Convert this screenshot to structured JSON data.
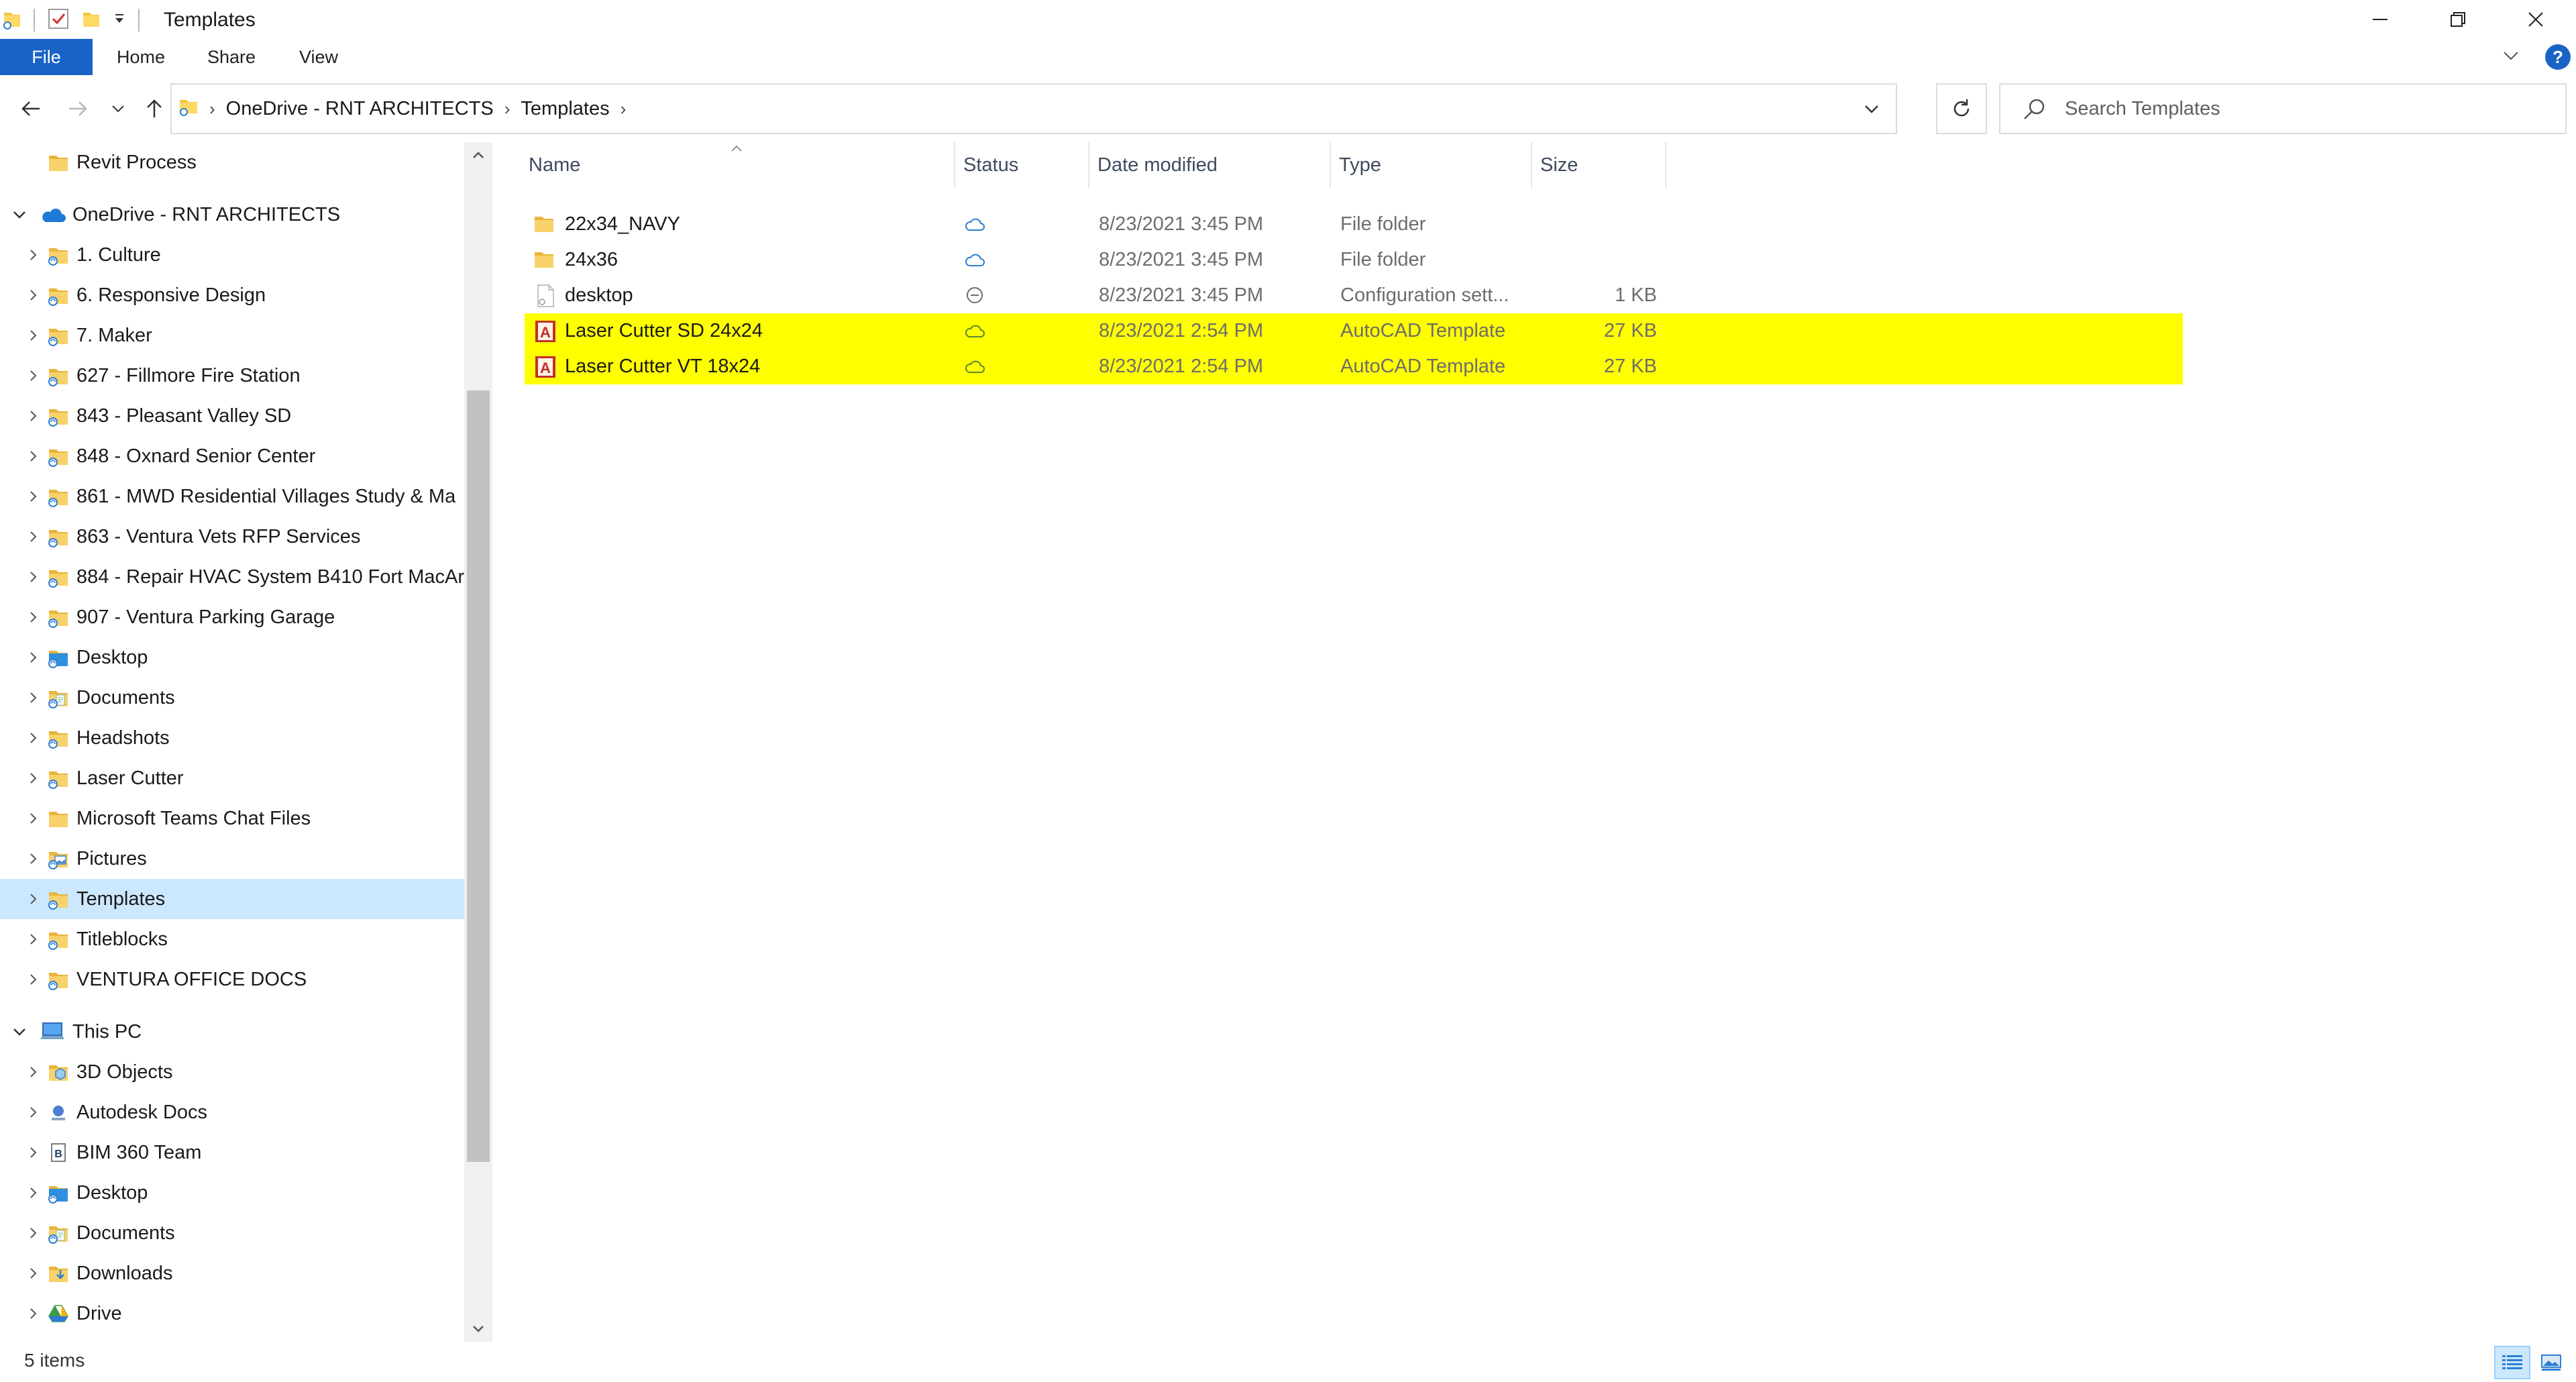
{
  "window": {
    "title": "Templates",
    "minimize_glyph": "—",
    "maximize_glyph": "❐",
    "close_glyph": "✕"
  },
  "ribbon": {
    "tabs": [
      "File",
      "Home",
      "Share",
      "View"
    ],
    "help_label": "?"
  },
  "address": {
    "crumbs": [
      "OneDrive - RNT ARCHITECTS",
      "Templates"
    ]
  },
  "search": {
    "placeholder": "Search Templates"
  },
  "nav_tree": [
    {
      "label": "Revit Process",
      "indent": 1,
      "icon": "folder-icon",
      "expander": "none"
    },
    {
      "label": "OneDrive - RNT ARCHITECTS",
      "indent": 0,
      "icon": "onedrive-cloud-icon",
      "expander": "expanded"
    },
    {
      "label": "1. Culture",
      "indent": 1,
      "icon": "sync-folder-icon",
      "expander": "collapsed"
    },
    {
      "label": "6. Responsive Design",
      "indent": 1,
      "icon": "sync-folder-icon",
      "expander": "collapsed"
    },
    {
      "label": "7. Maker",
      "indent": 1,
      "icon": "sync-folder-icon",
      "expander": "collapsed"
    },
    {
      "label": "627 - Fillmore Fire Station",
      "indent": 1,
      "icon": "sync-folder-icon",
      "expander": "collapsed"
    },
    {
      "label": "843 - Pleasant Valley SD",
      "indent": 1,
      "icon": "sync-folder-icon",
      "expander": "collapsed"
    },
    {
      "label": "848 - Oxnard Senior Center",
      "indent": 1,
      "icon": "sync-folder-icon",
      "expander": "collapsed"
    },
    {
      "label": "861 - MWD Residential Villages Study & Ma",
      "indent": 1,
      "icon": "sync-folder-icon",
      "expander": "collapsed"
    },
    {
      "label": "863 - Ventura Vets RFP Services",
      "indent": 1,
      "icon": "sync-folder-icon",
      "expander": "collapsed"
    },
    {
      "label": "884 - Repair HVAC System B410 Fort MacAr",
      "indent": 1,
      "icon": "sync-folder-icon",
      "expander": "collapsed"
    },
    {
      "label": "907 - Ventura Parking Garage",
      "indent": 1,
      "icon": "sync-folder-icon",
      "expander": "collapsed"
    },
    {
      "label": "Desktop",
      "indent": 1,
      "icon": "desktop-folder-icon",
      "expander": "collapsed"
    },
    {
      "label": "Documents",
      "indent": 1,
      "icon": "documents-folder-icon",
      "expander": "collapsed"
    },
    {
      "label": "Headshots",
      "indent": 1,
      "icon": "sync-folder-icon",
      "expander": "collapsed"
    },
    {
      "label": "Laser Cutter",
      "indent": 1,
      "icon": "sync-folder-icon",
      "expander": "collapsed"
    },
    {
      "label": "Microsoft Teams Chat Files",
      "indent": 1,
      "icon": "folder-icon",
      "expander": "collapsed"
    },
    {
      "label": "Pictures",
      "indent": 1,
      "icon": "pictures-folder-icon",
      "expander": "collapsed"
    },
    {
      "label": "Templates",
      "indent": 1,
      "icon": "sync-folder-icon",
      "expander": "collapsed",
      "selected": true
    },
    {
      "label": "Titleblocks",
      "indent": 1,
      "icon": "sync-folder-icon",
      "expander": "collapsed"
    },
    {
      "label": "VENTURA OFFICE DOCS",
      "indent": 1,
      "icon": "sync-folder-icon",
      "expander": "collapsed"
    },
    {
      "label": "This PC",
      "indent": 0,
      "icon": "this-pc-icon",
      "expander": "expanded"
    },
    {
      "label": "3D Objects",
      "indent": 1,
      "icon": "3d-objects-icon",
      "expander": "collapsed"
    },
    {
      "label": "Autodesk Docs",
      "indent": 1,
      "icon": "autodesk-docs-icon",
      "expander": "collapsed"
    },
    {
      "label": "BIM 360 Team",
      "indent": 1,
      "icon": "bim360-icon",
      "expander": "collapsed"
    },
    {
      "label": "Desktop",
      "indent": 1,
      "icon": "desktop-folder-icon",
      "expander": "collapsed"
    },
    {
      "label": "Documents",
      "indent": 1,
      "icon": "documents-folder-icon",
      "expander": "collapsed"
    },
    {
      "label": "Downloads",
      "indent": 1,
      "icon": "downloads-folder-icon",
      "expander": "collapsed"
    },
    {
      "label": "Drive",
      "indent": 1,
      "icon": "drive-icon",
      "expander": "collapsed"
    }
  ],
  "columns": [
    "Name",
    "Status",
    "Date modified",
    "Type",
    "Size"
  ],
  "files": [
    {
      "name": "22x34_NAVY",
      "status": "cloud",
      "date": "8/23/2021 3:45 PM",
      "type": "File folder",
      "size": "",
      "icon": "folder-icon",
      "highlighted": false
    },
    {
      "name": "24x36",
      "status": "cloud",
      "date": "8/23/2021 3:45 PM",
      "type": "File folder",
      "size": "",
      "icon": "folder-icon",
      "highlighted": false
    },
    {
      "name": "desktop",
      "status": "excluded",
      "date": "8/23/2021 3:45 PM",
      "type": "Configuration sett...",
      "size": "1 KB",
      "icon": "config-file-icon",
      "highlighted": false
    },
    {
      "name": "Laser Cutter SD 24x24",
      "status": "cloud",
      "date": "8/23/2021 2:54 PM",
      "type": "AutoCAD Template",
      "size": "27 KB",
      "icon": "autocad-template-icon",
      "highlighted": true
    },
    {
      "name": "Laser Cutter VT 18x24",
      "status": "cloud",
      "date": "8/23/2021 2:54 PM",
      "type": "AutoCAD Template",
      "size": "27 KB",
      "icon": "autocad-template-icon",
      "highlighted": true
    }
  ],
  "status_bar": {
    "item_count": "5 items"
  },
  "colors": {
    "accent": "#1a63c6",
    "selection": "#cce8ff",
    "highlight": "#ffff00",
    "folder": "#f4c542",
    "cloud_blue": "#2d7fd2",
    "cloud_green": "#5a8a2e"
  }
}
